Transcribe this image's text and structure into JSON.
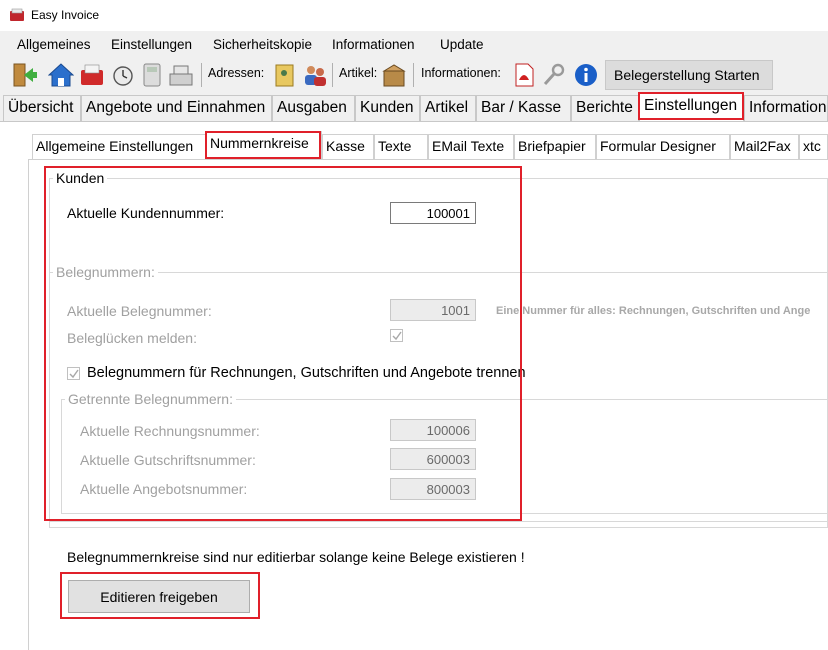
{
  "window": {
    "title": "Easy Invoice"
  },
  "menu": [
    "Allgemeines",
    "Einstellungen",
    "Sicherheitskopie",
    "Informationen",
    "Update"
  ],
  "toolbar": {
    "adressen_label": "Adressen:",
    "artikel_label": "Artikel:",
    "informationen_label": "Informationen:",
    "start_button": "Belegerstellung Starten"
  },
  "main_tabs": [
    "Übersicht",
    "Angebote und Einnahmen",
    "Ausgaben",
    "Kunden",
    "Artikel",
    "Bar / Kasse",
    "Berichte",
    "Einstellungen",
    "Informationen"
  ],
  "main_tabs_active": "Einstellungen",
  "sub_tabs": [
    "Allgemeine Einstellungen",
    "Nummernkreise",
    "Kasse",
    "Texte",
    "EMail Texte",
    "Briefpapier",
    "Formular Designer",
    "Mail2Fax",
    "xtc"
  ],
  "sub_tabs_active": "Nummernkreise",
  "kunden": {
    "legend": "Kunden",
    "label": "Aktuelle Kundennummer:",
    "value": "100001"
  },
  "belegnummern": {
    "legend": "Belegnummern:",
    "aktuelle_label": "Aktuelle Belegnummer:",
    "aktuelle_value": "1001",
    "hint": "Eine Nummer für alles: Rechnungen, Gutschriften und Ange",
    "luecken_label": "Beleglücken melden:",
    "luecken_checked": true,
    "trennen_label": "Belegnummern für Rechnungen, Gutschriften und Angebote trennen",
    "trennen_checked": true
  },
  "getrennte": {
    "legend": "Getrennte Belegnummern:",
    "rechnung_label": "Aktuelle Rechnungsnummer:",
    "rechnung_value": "100006",
    "gutschrift_label": "Aktuelle Gutschriftsnummer:",
    "gutschrift_value": "600003",
    "angebot_label": "Aktuelle Angebotsnummer:",
    "angebot_value": "800003"
  },
  "notice": "Belegnummernkreise sind nur editierbar solange keine Belege existieren !",
  "edit_button": "Editieren freigeben",
  "colors": {
    "highlight": "#e0202a",
    "disabled_text": "#a0a0a0",
    "window_bg": "#f0f0f0"
  }
}
